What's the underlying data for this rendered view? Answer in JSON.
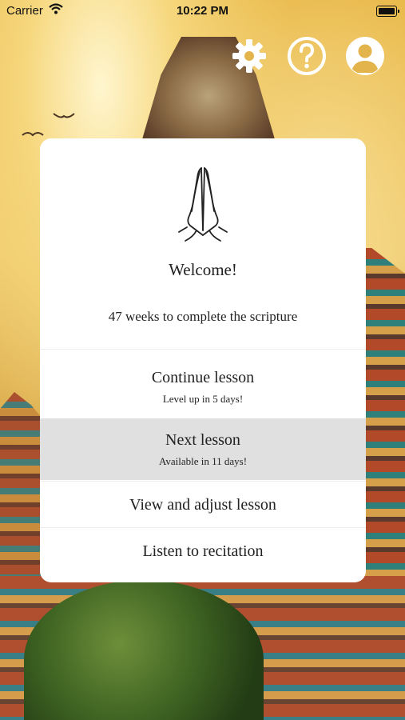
{
  "status_bar": {
    "carrier": "Carrier",
    "time": "10:22 PM"
  },
  "top_icons": [
    "gear-icon",
    "help-icon",
    "profile-icon"
  ],
  "card": {
    "icon": "praying-hands-icon",
    "welcome": "Welcome!",
    "progress_text": "47 weeks to complete the scripture",
    "rows": [
      {
        "title": "Continue lesson",
        "subtitle": "Level up in 5 days!"
      },
      {
        "title": "Next lesson",
        "subtitle": "Available in 11 days!"
      },
      {
        "title": "View and adjust lesson"
      },
      {
        "title": "Listen to recitation"
      }
    ]
  },
  "colors": {
    "card_bg": "#ffffff",
    "selected_row_bg": "#e0e0e0",
    "icon_color": "#ffffff"
  }
}
